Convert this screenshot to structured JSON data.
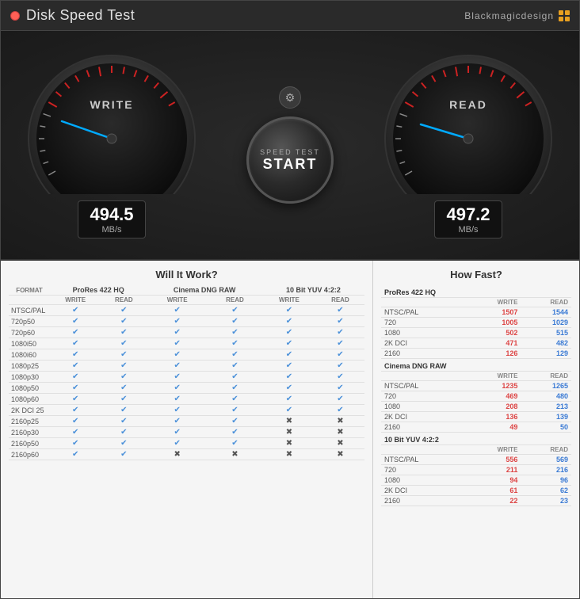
{
  "window": {
    "title": "Disk Speed Test",
    "brand": "Blackmagicdesign"
  },
  "gauges": {
    "write": {
      "label": "WRITE",
      "value": "494.5",
      "unit": "MB/s"
    },
    "read": {
      "label": "READ",
      "value": "497.2",
      "unit": "MB/s"
    }
  },
  "start_button": {
    "label": "SPEED TEST",
    "text": "START"
  },
  "left_panel": {
    "title": "Will It Work?",
    "col_groups": [
      "ProRes 422 HQ",
      "Cinema DNG RAW",
      "10 Bit YUV 4:2:2"
    ],
    "sub_headers": [
      "WRITE",
      "READ"
    ],
    "format_label": "FORMAT",
    "rows": [
      {
        "label": "NTSC/PAL",
        "checks": [
          true,
          true,
          true,
          true,
          true,
          true
        ]
      },
      {
        "label": "720p50",
        "checks": [
          true,
          true,
          true,
          true,
          true,
          true
        ]
      },
      {
        "label": "720p60",
        "checks": [
          true,
          true,
          true,
          true,
          true,
          true
        ]
      },
      {
        "label": "1080i50",
        "checks": [
          true,
          true,
          true,
          true,
          true,
          true
        ]
      },
      {
        "label": "1080i60",
        "checks": [
          true,
          true,
          true,
          true,
          true,
          true
        ]
      },
      {
        "label": "1080p25",
        "checks": [
          true,
          true,
          true,
          true,
          true,
          true
        ]
      },
      {
        "label": "1080p30",
        "checks": [
          true,
          true,
          true,
          true,
          true,
          true
        ]
      },
      {
        "label": "1080p50",
        "checks": [
          true,
          true,
          true,
          true,
          true,
          true
        ]
      },
      {
        "label": "1080p60",
        "checks": [
          true,
          true,
          true,
          true,
          true,
          true
        ]
      },
      {
        "label": "2K DCI 25",
        "checks": [
          true,
          true,
          true,
          true,
          true,
          true
        ]
      },
      {
        "label": "2160p25",
        "checks": [
          true,
          true,
          true,
          true,
          false,
          false
        ]
      },
      {
        "label": "2160p30",
        "checks": [
          true,
          true,
          true,
          true,
          false,
          false
        ]
      },
      {
        "label": "2160p50",
        "checks": [
          true,
          true,
          true,
          true,
          false,
          false
        ]
      },
      {
        "label": "2160p60",
        "checks": [
          true,
          true,
          false,
          false,
          false,
          false
        ]
      }
    ]
  },
  "right_panel": {
    "title": "How Fast?",
    "groups": [
      {
        "name": "ProRes 422 HQ",
        "rows": [
          {
            "label": "NTSC/PAL",
            "write": 1507,
            "read": 1544
          },
          {
            "label": "720",
            "write": 1005,
            "read": 1029
          },
          {
            "label": "1080",
            "write": 502,
            "read": 515
          },
          {
            "label": "2K DCI",
            "write": 471,
            "read": 482
          },
          {
            "label": "2160",
            "write": 126,
            "read": 129
          }
        ]
      },
      {
        "name": "Cinema DNG RAW",
        "rows": [
          {
            "label": "NTSC/PAL",
            "write": 1235,
            "read": 1265
          },
          {
            "label": "720",
            "write": 469,
            "read": 480
          },
          {
            "label": "1080",
            "write": 208,
            "read": 213
          },
          {
            "label": "2K DCI",
            "write": 136,
            "read": 139
          },
          {
            "label": "2160",
            "write": 49,
            "read": 50
          }
        ]
      },
      {
        "name": "10 Bit YUV 4:2:2",
        "rows": [
          {
            "label": "NTSC/PAL",
            "write": 556,
            "read": 569
          },
          {
            "label": "720",
            "write": 211,
            "read": 216
          },
          {
            "label": "1080",
            "write": 94,
            "read": 96
          },
          {
            "label": "2K DCI",
            "write": 61,
            "read": 62
          },
          {
            "label": "2160",
            "write": 22,
            "read": 23
          }
        ]
      }
    ]
  }
}
